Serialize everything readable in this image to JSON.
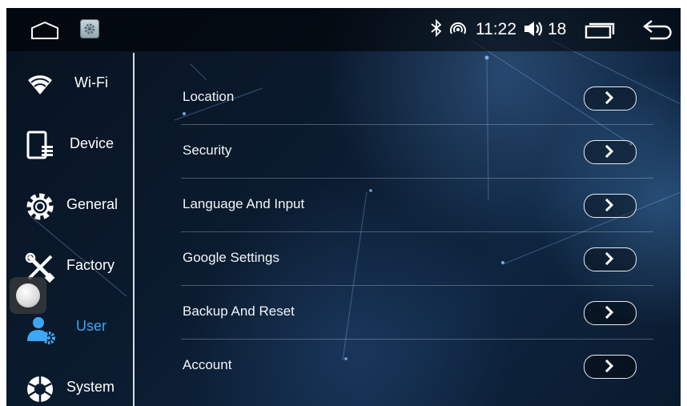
{
  "statusbar": {
    "time": "11:22",
    "volume": "18",
    "icons": [
      "home-icon",
      "settings-app-icon",
      "bluetooth-icon",
      "hotspot-icon",
      "volume-icon",
      "recent-apps-icon",
      "back-icon"
    ]
  },
  "sidebar": {
    "items": [
      {
        "label": "Wi-Fi",
        "icon": "wifi-icon",
        "active": false
      },
      {
        "label": "Device",
        "icon": "device-icon",
        "active": false
      },
      {
        "label": "General",
        "icon": "gear-icon",
        "active": false
      },
      {
        "label": "Factory",
        "icon": "tools-icon",
        "active": false
      },
      {
        "label": "User",
        "icon": "user-settings-icon",
        "active": true
      },
      {
        "label": "System",
        "icon": "system-icon",
        "active": false
      }
    ],
    "active_color": "#3ea7f5"
  },
  "list": {
    "items": [
      {
        "label": "Location"
      },
      {
        "label": "Security"
      },
      {
        "label": "Language And Input"
      },
      {
        "label": "Google Settings"
      },
      {
        "label": "Backup And Reset"
      },
      {
        "label": "Account"
      }
    ]
  }
}
